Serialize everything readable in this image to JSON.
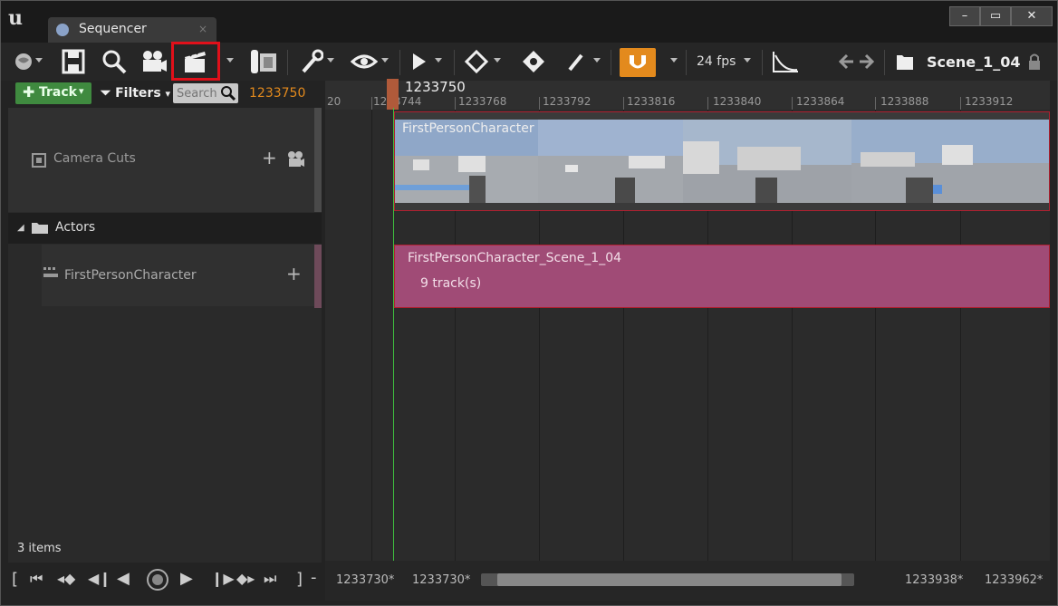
{
  "window": {
    "tab_title": "Sequencer",
    "tab_close": "×",
    "minimize": "–",
    "maximize": "▭",
    "close": "✕"
  },
  "toolbar": {
    "fps": "24 fps",
    "scene": "Scene_1_04",
    "highlight_color": "#e0101a",
    "magnet_color": "#e38a1d"
  },
  "filterbar": {
    "track_label": "Track",
    "filters_label": "Filters",
    "search_placeholder": "Search",
    "current_frame": "1233750"
  },
  "tree": {
    "camera_cuts": "Camera Cuts",
    "actors": "Actors",
    "fpc": "FirstPersonCharacter",
    "items_count": "3 items"
  },
  "ruler": {
    "playhead_frame": "1233750",
    "ticks": [
      "20",
      "1233744",
      "1233768",
      "1233792",
      "1233816",
      "1233840",
      "1233864",
      "1233888",
      "1233912"
    ]
  },
  "timeline": {
    "camera_section_label": "FirstPersonCharacter",
    "actor_section_name": "FirstPersonCharacter_Scene_1_04",
    "actor_section_tracks": "9 track(s)",
    "actor_color": "#a04b76",
    "section_border_color": "#b02030"
  },
  "bottom": {
    "start1": "1233730*",
    "start2": "1233730*",
    "end1": "1233938*",
    "end2": "1233962*"
  }
}
